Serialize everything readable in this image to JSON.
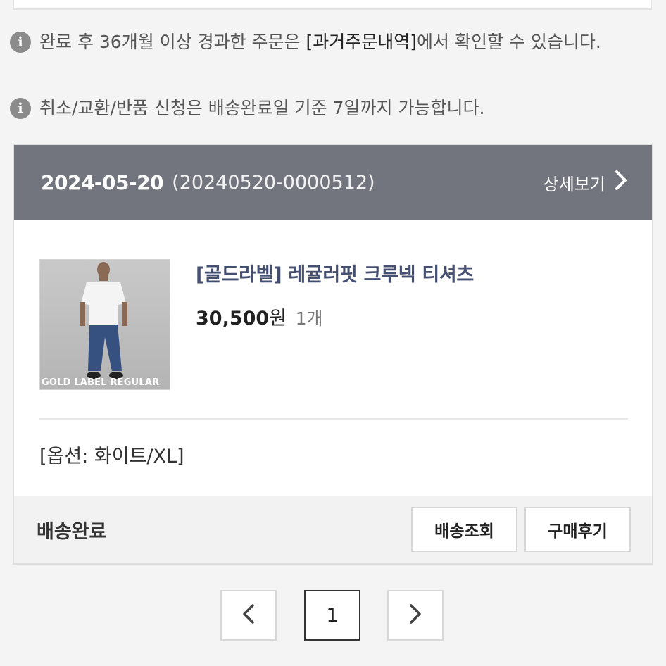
{
  "notices": [
    {
      "icon": "info-icon",
      "text_before": "완료 후 36개월 이상 경과한 주문은 ",
      "highlight": "[과거주문내역]",
      "text_after": "에서 확인할 수 있습니다."
    },
    {
      "icon": "info-icon",
      "text": "취소/교환/반품 신청은 배송완료일 기준 7일까지 가능합니다."
    }
  ],
  "order": {
    "date": "2024-05-20",
    "order_number": "(20240520-0000512)",
    "detail_link": "상세보기",
    "product": {
      "name": "[골드라벨] 레귤러핏 크루넥 티셔츠",
      "price": "30,500",
      "price_unit": "원",
      "quantity": "1개",
      "image_caption": "GOLD LABEL REGULAR"
    },
    "option": "[옵션: 화이트/XL]",
    "status": "배송완료",
    "buttons": {
      "track": "배송조회",
      "review": "구매후기"
    }
  },
  "pagination": {
    "current": "1",
    "prev_icon": "chevron-left-icon",
    "next_icon": "chevron-right-icon"
  },
  "colors": {
    "header_bg": "#72757d",
    "product_name": "#454f72",
    "page_bg": "#f4f4f4"
  }
}
